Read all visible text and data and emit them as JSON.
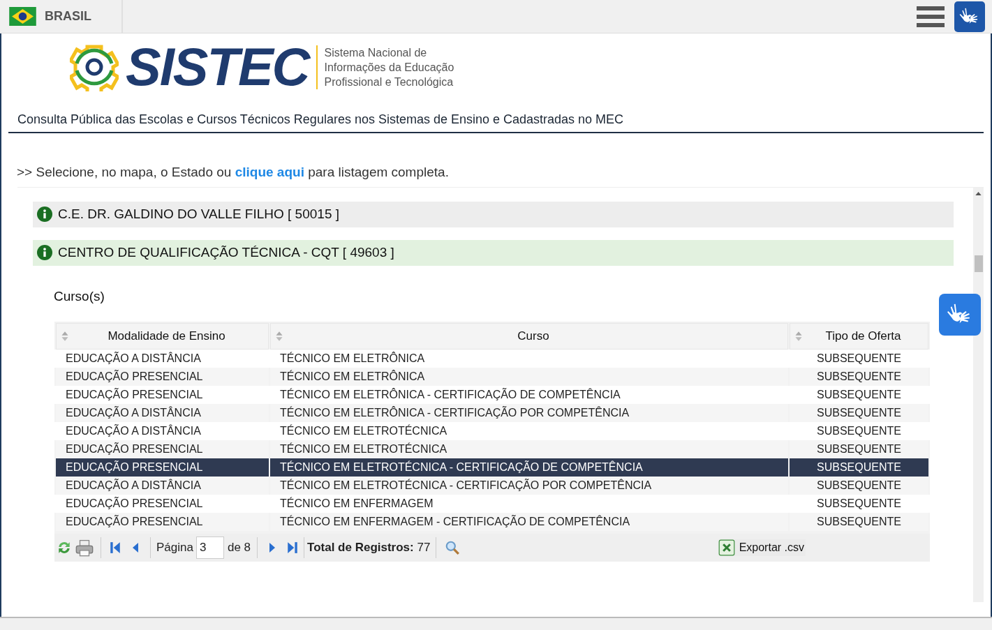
{
  "topbar": {
    "country": "BRASIL"
  },
  "logo": {
    "wordmark": "SISTEC",
    "tagline": [
      "Sistema Nacional de",
      "Informações da Educação",
      "Profissional e Tecnológica"
    ]
  },
  "page_title": "Consulta Pública das Escolas e Cursos Técnicos Regulares nos Sistemas de Ensino e Cadastradas no MEC",
  "instruction": {
    "prefix": ">>",
    "before": "Selecione, no mapa, o Estado ou",
    "link": "clique aqui",
    "after": "para listagem completa."
  },
  "schools": [
    {
      "name": "C.E. DR. GALDINO DO VALLE FILHO [ 50015 ]",
      "color": "#ededed"
    },
    {
      "name": "CENTRO DE QUALIFICAÇÃO TÉCNICA - CQT [ 49603 ]",
      "color": "#e2f1df"
    }
  ],
  "courses_heading": "Curso(s)",
  "table": {
    "columns": [
      "Modalidade de Ensino",
      "Curso",
      "Tipo de Oferta"
    ],
    "rows": [
      {
        "cells": [
          "EDUCAÇÃO A DISTÂNCIA",
          "TÉCNICO EM ELETRÔNICA",
          "SUBSEQUENTE"
        ],
        "selected": false
      },
      {
        "cells": [
          "EDUCAÇÃO PRESENCIAL",
          "TÉCNICO EM ELETRÔNICA",
          "SUBSEQUENTE"
        ],
        "selected": false
      },
      {
        "cells": [
          "EDUCAÇÃO PRESENCIAL",
          "TÉCNICO EM ELETRÔNICA - CERTIFICAÇÃO DE COMPETÊNCIA",
          "SUBSEQUENTE"
        ],
        "selected": false
      },
      {
        "cells": [
          "EDUCAÇÃO A DISTÂNCIA",
          "TÉCNICO EM ELETRÔNICA - CERTIFICAÇÃO POR COMPETÊNCIA",
          "SUBSEQUENTE"
        ],
        "selected": false
      },
      {
        "cells": [
          "EDUCAÇÃO A DISTÂNCIA",
          "TÉCNICO EM ELETROTÉCNICA",
          "SUBSEQUENTE"
        ],
        "selected": false
      },
      {
        "cells": [
          "EDUCAÇÃO PRESENCIAL",
          "TÉCNICO EM ELETROTÉCNICA",
          "SUBSEQUENTE"
        ],
        "selected": false
      },
      {
        "cells": [
          "EDUCAÇÃO PRESENCIAL",
          "TÉCNICO EM ELETROTÉCNICA - CERTIFICAÇÃO DE COMPETÊNCIA",
          "SUBSEQUENTE"
        ],
        "selected": true
      },
      {
        "cells": [
          "EDUCAÇÃO A DISTÂNCIA",
          "TÉCNICO EM ELETROTÉCNICA - CERTIFICAÇÃO POR COMPETÊNCIA",
          "SUBSEQUENTE"
        ],
        "selected": false
      },
      {
        "cells": [
          "EDUCAÇÃO PRESENCIAL",
          "TÉCNICO EM ENFERMAGEM",
          "SUBSEQUENTE"
        ],
        "selected": false
      },
      {
        "cells": [
          "EDUCAÇÃO PRESENCIAL",
          "TÉCNICO EM ENFERMAGEM - CERTIFICAÇÃO DE COMPETÊNCIA",
          "SUBSEQUENTE"
        ],
        "selected": false
      }
    ]
  },
  "pager": {
    "page_label": "Página",
    "page": "3",
    "of": "de 8",
    "total_label": "Total de Registros:",
    "total": "77",
    "export": "Exportar .csv"
  }
}
